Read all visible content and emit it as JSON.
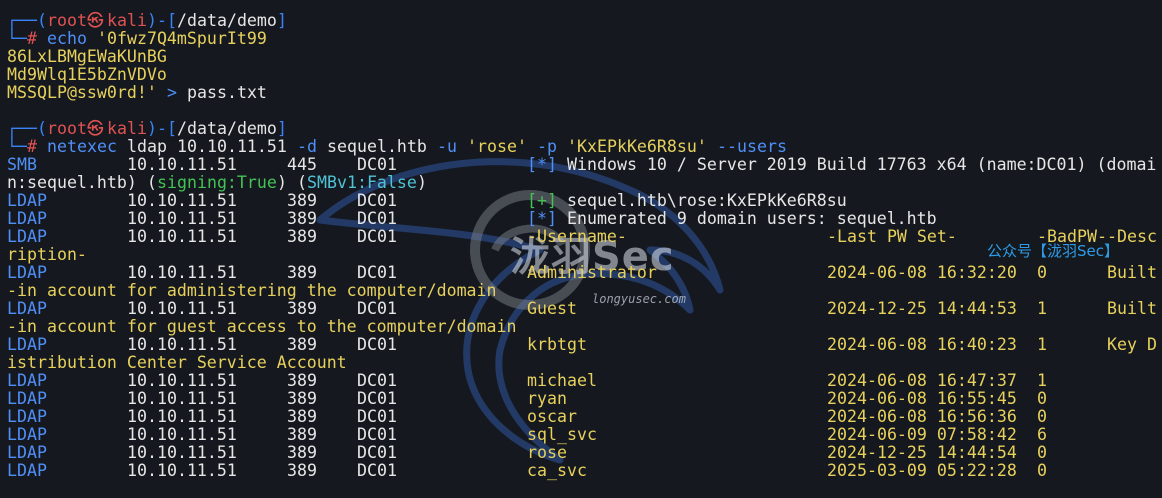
{
  "prompt1": {
    "open": "┌──(",
    "user": "root",
    "at": "㉿",
    "host": "kali",
    "mid": ")-[",
    "path": "/data/demo",
    "close": "]",
    "hash_prefix": "└─",
    "hash": "#",
    "cmd": "echo",
    "arg": "'0fwz7Q4mSpurIt99",
    "cont1": "86LxLBMgEWaKUnBG",
    "cont2": "Md9Wlq1E5bZnVDVo",
    "cont3": "MSSQLP@ssw0rd!'",
    "redir": ">",
    "file": "pass.txt"
  },
  "prompt2": {
    "open": "┌──(",
    "user": "root",
    "at": "㉿",
    "host": "kali",
    "mid": ")-[",
    "path": "/data/demo",
    "close": "]",
    "hash_prefix": "└─",
    "hash": "#",
    "cmd": "netexec",
    "proto": "ldap",
    "ip": "10.10.11.51",
    "flag_d": "-d",
    "domain": "sequel.htb",
    "flag_u": "-u",
    "user_val": "'rose'",
    "flag_p": "-p",
    "pass_val": "'KxEPkKe6R8su'",
    "flag_users": "--users"
  },
  "output": {
    "smb_line": {
      "proto": "SMB",
      "ip": "10.10.11.51",
      "port": "445",
      "host": "DC01",
      "tag": "[*]",
      "msg": "Windows 10 / Server 2019 Build 17763 x64 (name:DC01) (domai",
      "wrap_a": "n:sequel.htb) (",
      "signing": "signing:True",
      "wrap_b": ") (",
      "smbv1": "SMBv1:False",
      "wrap_c": ")"
    },
    "ldap_rows": [
      {
        "proto": "LDAP",
        "ip": "10.10.11.51",
        "port": "389",
        "host": "DC01",
        "tag": "[+]",
        "tag_color": "green",
        "msg": "sequel.htb\\rose:KxEPkKe6R8su"
      },
      {
        "proto": "LDAP",
        "ip": "10.10.11.51",
        "port": "389",
        "host": "DC01",
        "tag": "[*]",
        "tag_color": "blue",
        "msg": "Enumerated 9 domain users: sequel.htb"
      }
    ],
    "header": {
      "proto": "LDAP",
      "ip": "10.10.11.51",
      "port": "389",
      "host": "DC01",
      "username": "-Username-",
      "lastpw": "-Last PW Set-",
      "badpw": "-BadPW-",
      "desc": "-Desc",
      "wrap": "ription-"
    },
    "users": [
      {
        "proto": "LDAP",
        "ip": "10.10.11.51",
        "port": "389",
        "host": "DC01",
        "name": "Administrator",
        "pwset": "2024-06-08 16:32:20",
        "bad": "0",
        "desc": "Built",
        "wrap": "-in account for administering the computer/domain"
      },
      {
        "proto": "LDAP",
        "ip": "10.10.11.51",
        "port": "389",
        "host": "DC01",
        "name": "Guest",
        "pwset": "2024-12-25 14:44:53",
        "bad": "1",
        "desc": "Built",
        "wrap": "-in account for guest access to the computer/domain"
      },
      {
        "proto": "LDAP",
        "ip": "10.10.11.51",
        "port": "389",
        "host": "DC01",
        "name": "krbtgt",
        "pwset": "2024-06-08 16:40:23",
        "bad": "1",
        "desc": "Key D",
        "wrap": "istribution Center Service Account"
      },
      {
        "proto": "LDAP",
        "ip": "10.10.11.51",
        "port": "389",
        "host": "DC01",
        "name": "michael",
        "pwset": "2024-06-08 16:47:37",
        "bad": "1",
        "desc": "",
        "wrap": ""
      },
      {
        "proto": "LDAP",
        "ip": "10.10.11.51",
        "port": "389",
        "host": "DC01",
        "name": "ryan",
        "pwset": "2024-06-08 16:55:45",
        "bad": "0",
        "desc": "",
        "wrap": ""
      },
      {
        "proto": "LDAP",
        "ip": "10.10.11.51",
        "port": "389",
        "host": "DC01",
        "name": "oscar",
        "pwset": "2024-06-08 16:56:36",
        "bad": "0",
        "desc": "",
        "wrap": ""
      },
      {
        "proto": "LDAP",
        "ip": "10.10.11.51",
        "port": "389",
        "host": "DC01",
        "name": "sql_svc",
        "pwset": "2024-06-09 07:58:42",
        "bad": "6",
        "desc": "",
        "wrap": ""
      },
      {
        "proto": "LDAP",
        "ip": "10.10.11.51",
        "port": "389",
        "host": "DC01",
        "name": "rose",
        "pwset": "2024-12-25 14:44:54",
        "bad": "0",
        "desc": "",
        "wrap": ""
      },
      {
        "proto": "LDAP",
        "ip": "10.10.11.51",
        "port": "389",
        "host": "DC01",
        "name": "ca_svc",
        "pwset": "2025-03-09 05:22:28",
        "bad": "0",
        "desc": "",
        "wrap": ""
      }
    ]
  },
  "watermark": {
    "brand": "泷羽Sec",
    "url": "longyusec.com",
    "label": "公众号【泷羽Sec】"
  },
  "colors": {
    "background": "#15191f",
    "prompt_blue": "#3b82f6",
    "root_red": "#e05252",
    "string_yellow": "#e7d15c",
    "ok_green": "#42c353",
    "info_cyan": "#4fc3d6"
  }
}
